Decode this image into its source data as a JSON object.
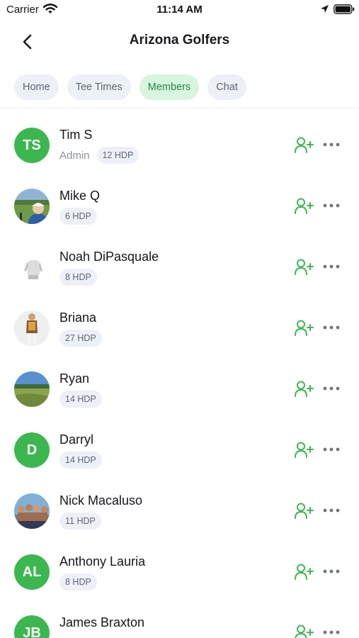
{
  "status_bar": {
    "carrier": "Carrier",
    "time": "11:14 AM"
  },
  "nav": {
    "title": "Arizona Golfers"
  },
  "tabs": [
    {
      "label": "Home",
      "active": false
    },
    {
      "label": "Tee Times",
      "active": false
    },
    {
      "label": "Members",
      "active": true
    },
    {
      "label": "Chat",
      "active": false
    }
  ],
  "colors": {
    "accent": "#3cb74f",
    "active_tab_bg": "#d8f5df",
    "chip_bg": "#eef0f7"
  },
  "members": [
    {
      "name": "Tim S",
      "role": "Admin",
      "hdp": "12 HDP",
      "avatar": "initials",
      "initials": "TS"
    },
    {
      "name": "Mike Q",
      "role": "",
      "hdp": "6 HDP",
      "avatar": "photo",
      "photo": "golfer"
    },
    {
      "name": "Noah DiPasquale",
      "role": "",
      "hdp": "8 HDP",
      "avatar": "photo",
      "photo": "shirt"
    },
    {
      "name": "Briana",
      "role": "",
      "hdp": "27 HDP",
      "avatar": "photo",
      "photo": "person"
    },
    {
      "name": "Ryan",
      "role": "",
      "hdp": "14 HDP",
      "avatar": "photo",
      "photo": "field"
    },
    {
      "name": "Darryl",
      "role": "",
      "hdp": "14 HDP",
      "avatar": "initials",
      "initials": "D"
    },
    {
      "name": "Nick Macaluso",
      "role": "",
      "hdp": "11 HDP",
      "avatar": "photo",
      "photo": "group"
    },
    {
      "name": "Anthony Lauria",
      "role": "",
      "hdp": "8 HDP",
      "avatar": "initials",
      "initials": "AL"
    },
    {
      "name": "James Braxton",
      "role": "",
      "hdp": "",
      "avatar": "initials",
      "initials": "JB"
    }
  ],
  "icons": {
    "back": "chevron-left-icon",
    "add": "add-user-icon",
    "more": "more-icon"
  }
}
